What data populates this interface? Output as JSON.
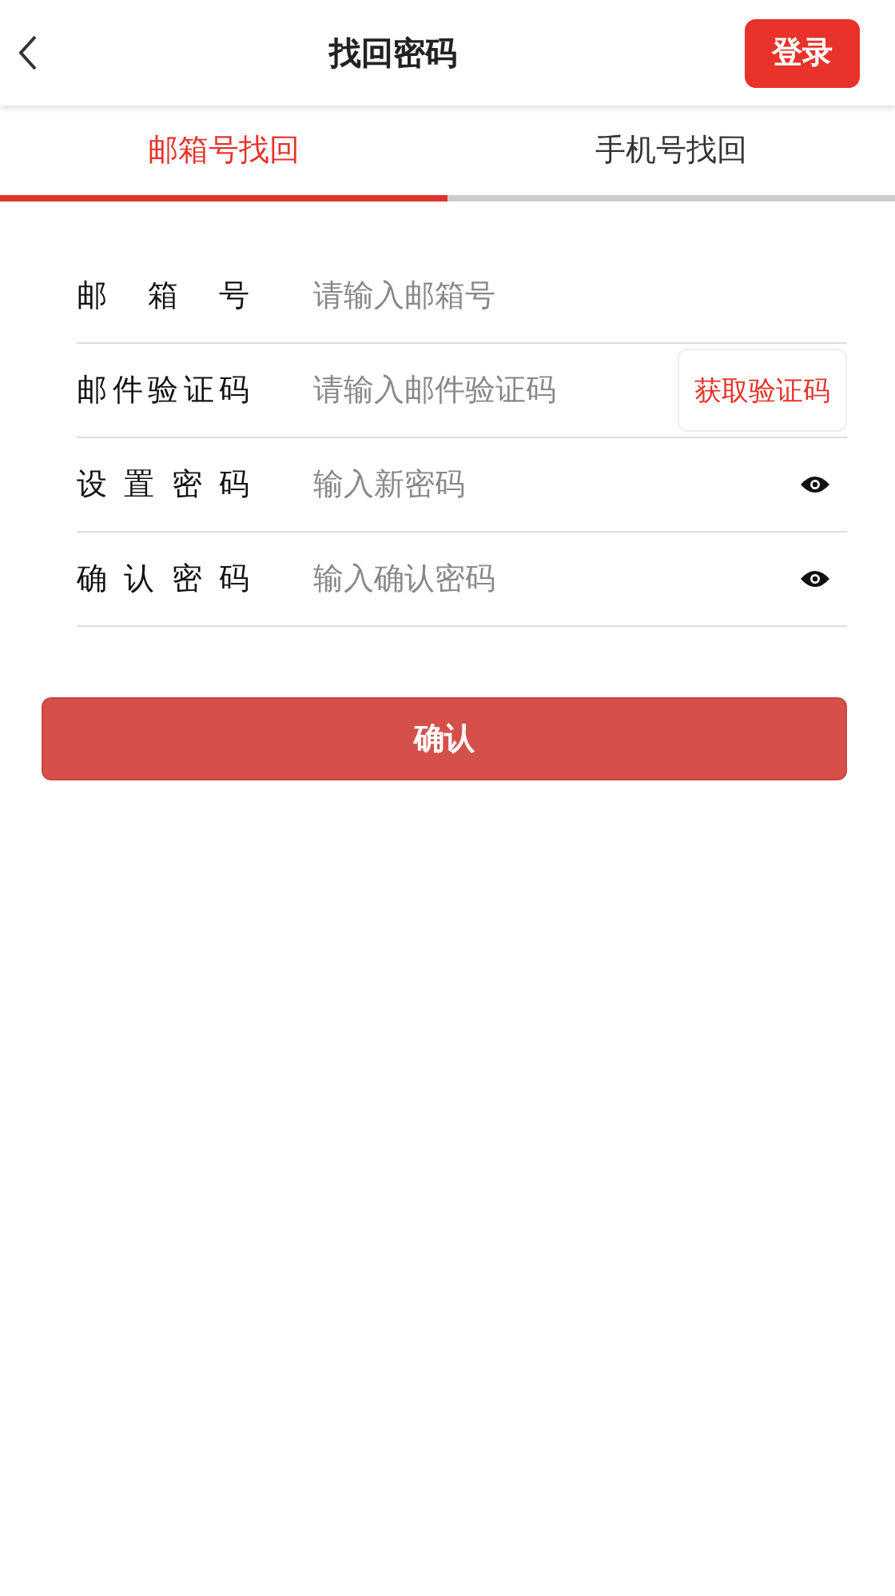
{
  "header": {
    "title": "找回密码",
    "login_button": "登录"
  },
  "tabs": [
    {
      "label": "邮箱号找回",
      "selected": true
    },
    {
      "label": "手机号找回",
      "selected": false
    }
  ],
  "fields": [
    {
      "kind": "text",
      "label": "邮箱号",
      "placeholder": "请输入邮箱号"
    },
    {
      "kind": "code",
      "label": "邮件验证码",
      "placeholder": "请输入邮件验证码",
      "action": "获取验证码"
    },
    {
      "kind": "password",
      "label": "设置密码",
      "placeholder": "输入新密码"
    },
    {
      "kind": "password",
      "label": "确认密码",
      "placeholder": "输入确认密码"
    }
  ],
  "submit": "确认"
}
